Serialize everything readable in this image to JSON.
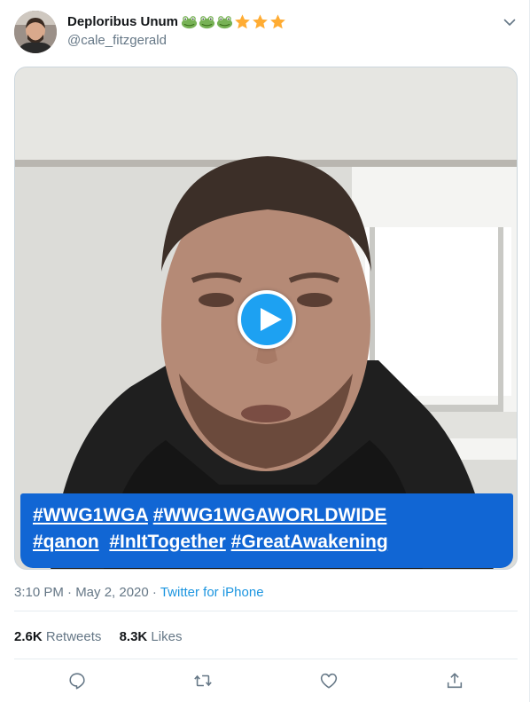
{
  "tweet": {
    "author": {
      "display_name": "Deploribus Unum",
      "handle": "@cale_fitzgerald",
      "name_emoji": [
        "frog-emoji",
        "frog-emoji",
        "frog-emoji",
        "star-emoji",
        "star-emoji",
        "star-emoji"
      ]
    },
    "media": {
      "type": "video",
      "hashtags_line1": [
        "#WWG1WGA",
        "#WWG1WGAWORLDWIDE"
      ],
      "hashtags_line2": [
        "#qanon",
        "#InItTogether",
        "#GreatAwakening"
      ]
    },
    "timestamp": "3:10 PM · May 2, 2020 · ",
    "source": "Twitter for iPhone",
    "stats": {
      "retweets_count": "2.6K",
      "retweets_label": "Retweets",
      "likes_count": "8.3K",
      "likes_label": "Likes"
    },
    "actions": [
      "reply-icon",
      "retweet-icon",
      "like-icon",
      "share-icon"
    ]
  },
  "colors": {
    "accent": "#1da1f2",
    "link": "#1b95e0",
    "hashtag_box": "#1166d4",
    "secondary_text": "#657786",
    "primary_text": "#14171a"
  }
}
